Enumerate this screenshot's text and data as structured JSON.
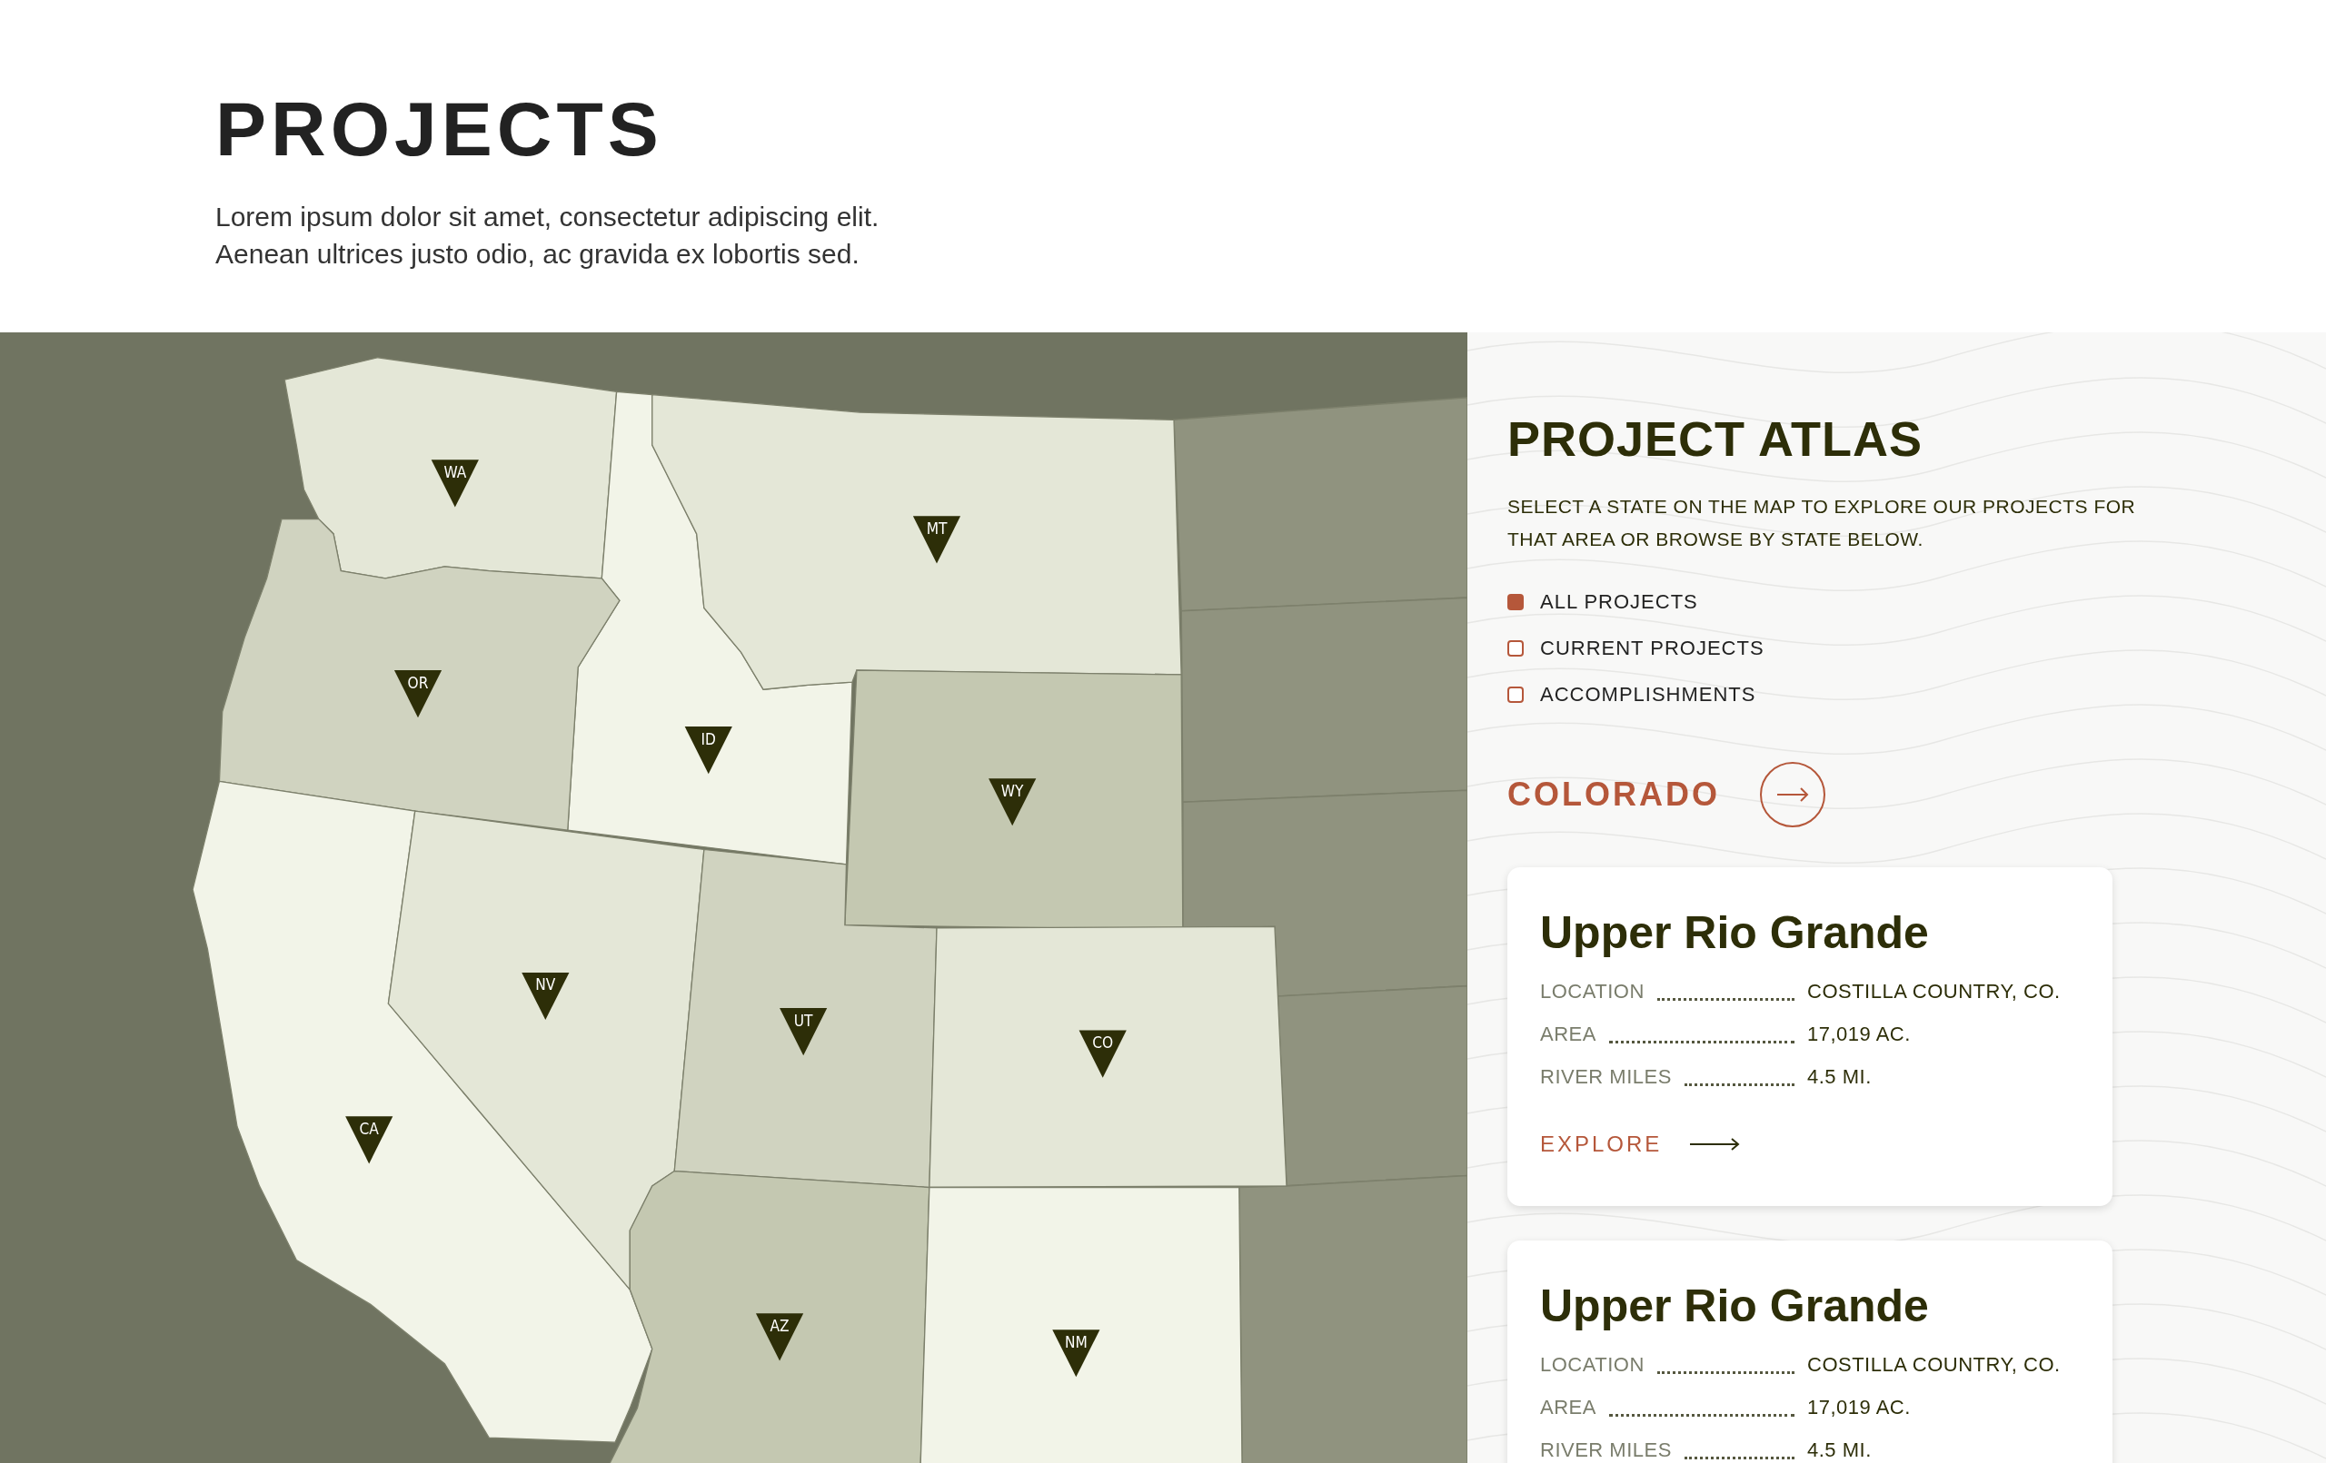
{
  "header": {
    "title": "PROJECTS",
    "description": "Lorem ipsum dolor sit amet, consectetur adipiscing elit. Aenean ultrices justo odio, ac gravida ex lobortis sed."
  },
  "map": {
    "states": [
      {
        "label": "WA",
        "color": "#e4e7d7"
      },
      {
        "label": "ID",
        "color": "#f2f4e8"
      },
      {
        "label": "MT",
        "color": "#e4e7d7"
      },
      {
        "label": "OR",
        "color": "#d0d3c0"
      },
      {
        "label": "WY",
        "color": "#c4c8b1"
      },
      {
        "label": "CA",
        "color": "#f2f4e8"
      },
      {
        "label": "NV",
        "color": "#e4e7d7"
      },
      {
        "label": "UT",
        "color": "#d0d3c0"
      },
      {
        "label": "CO",
        "color": "#e4e7d7"
      },
      {
        "label": "AZ",
        "color": "#c4c8b1"
      },
      {
        "label": "NM",
        "color": "#f2f4e8"
      }
    ]
  },
  "atlas": {
    "title": "PROJECT ATLAS",
    "description": "SELECT A STATE ON THE MAP TO EXPLORE OUR PROJECTS FOR THAT AREA OR BROWSE BY STATE BELOW.",
    "filters": [
      {
        "label": "ALL PROJECTS",
        "selected": true
      },
      {
        "label": "CURRENT PROJECTS",
        "selected": false
      },
      {
        "label": "ACCOMPLISHMENTS",
        "selected": false
      }
    ],
    "state_heading": "COLORADO",
    "projects": [
      {
        "title": "Upper Rio Grande",
        "fields": [
          {
            "label": "LOCATION",
            "value": "COSTILLA COUNTRY, CO."
          },
          {
            "label": "AREA",
            "value": "17,019 AC."
          },
          {
            "label": "RIVER MILES",
            "value": "4.5 MI."
          }
        ],
        "link": "EXPLORE"
      },
      {
        "title": "Upper Rio Grande",
        "fields": [
          {
            "label": "LOCATION",
            "value": "COSTILLA COUNTRY, CO."
          },
          {
            "label": "AREA",
            "value": "17,019 AC."
          },
          {
            "label": "RIVER MILES",
            "value": "4.5 MI."
          }
        ]
      }
    ]
  }
}
